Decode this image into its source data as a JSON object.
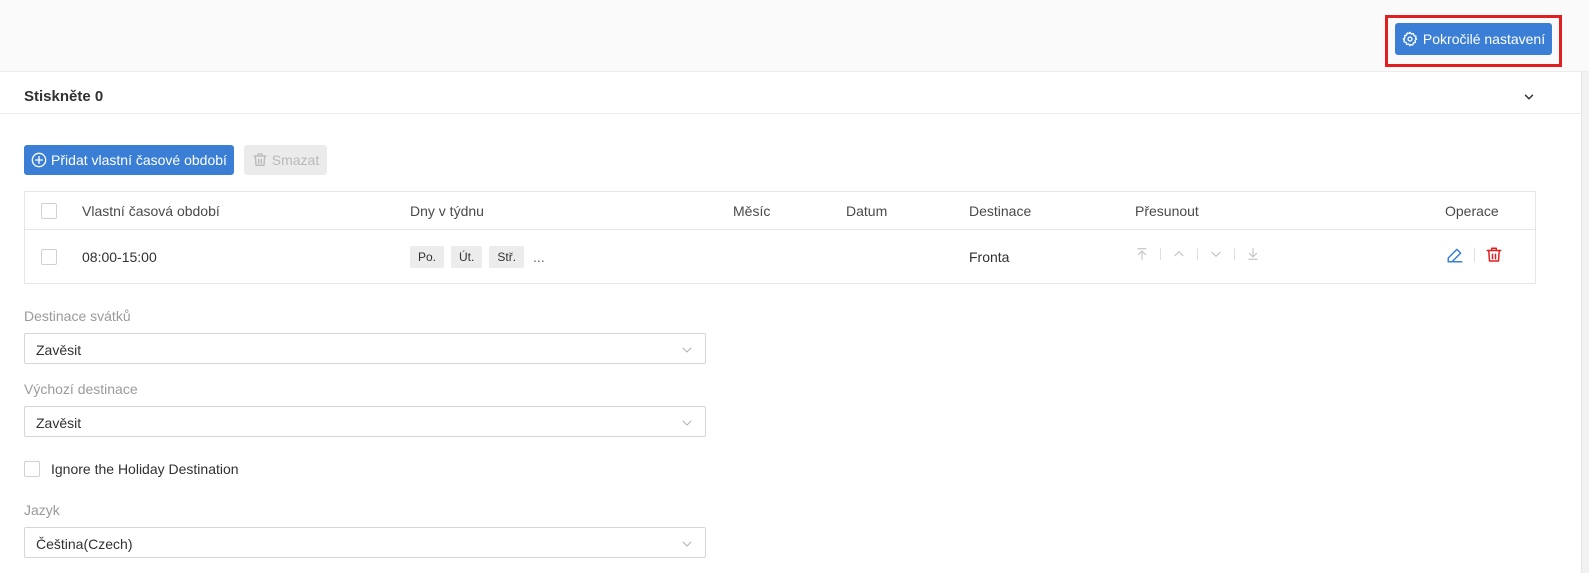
{
  "toolbar": {
    "advanced_settings_label": "Pokročilé nastavení"
  },
  "section": {
    "title": "Stiskněte 0"
  },
  "actions": {
    "add_label": "Přidat vlastní časové období",
    "delete_label": "Smazat"
  },
  "table": {
    "headers": {
      "period": "Vlastní časová období",
      "days": "Dny v týdnu",
      "month": "Měsíc",
      "date": "Datum",
      "destination": "Destinace",
      "move": "Přesunout",
      "operations": "Operace"
    },
    "rows": [
      {
        "period": "08:00-15:00",
        "days": [
          "Po.",
          "Út.",
          "Stř."
        ],
        "days_more": "...",
        "month": "",
        "date": "",
        "destination": "Fronta"
      }
    ]
  },
  "form": {
    "holiday_destination": {
      "label": "Destinace svátků",
      "value": "Zavěsit"
    },
    "default_destination": {
      "label": "Výchozí destinace",
      "value": "Zavěsit"
    },
    "ignore_holiday": {
      "label": "Ignore the Holiday Destination",
      "checked": false
    },
    "language": {
      "label": "Jazyk",
      "value": "Čeština(Czech)"
    }
  },
  "colors": {
    "primary": "#3a7fd5",
    "danger": "#e02020",
    "highlight_border": "#e02020",
    "muted_text": "#9a9a9a"
  },
  "icons": {
    "advanced": "gear-icon",
    "add": "plus-circle-icon",
    "delete": "trash-icon",
    "collapse": "chevron-down-icon",
    "move_top": "arrow-to-top-icon",
    "move_up": "chevron-up-icon",
    "move_down": "chevron-down-icon",
    "move_bottom": "arrow-to-bottom-icon",
    "edit": "pencil-icon",
    "remove": "trash-icon"
  }
}
